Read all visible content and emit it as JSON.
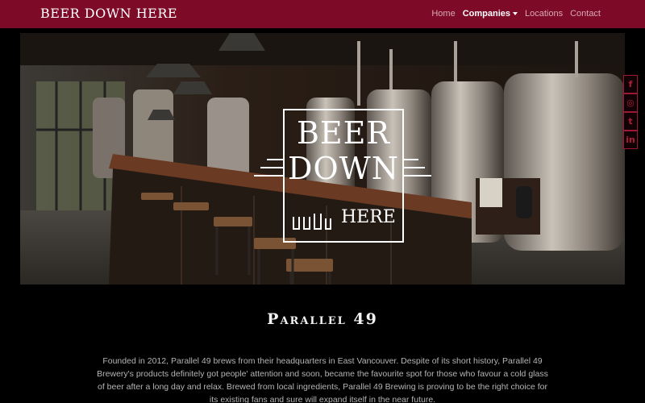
{
  "navbar": {
    "brand": "BEER DOWN HERE",
    "items": [
      {
        "label": "Home",
        "active": false
      },
      {
        "label": "Companies",
        "active": true
      },
      {
        "label": "Locations",
        "active": false
      },
      {
        "label": "Contact",
        "active": false
      }
    ]
  },
  "hero": {
    "logo": {
      "line1": "BEER",
      "line2": "DOWN",
      "line3": "HERE"
    }
  },
  "social": [
    {
      "icon": "facebook-icon",
      "glyph": "f"
    },
    {
      "icon": "instagram-icon",
      "glyph": "◎"
    },
    {
      "icon": "twitter-icon",
      "glyph": "t"
    },
    {
      "icon": "linkedin-icon",
      "glyph": "in"
    }
  ],
  "content": {
    "title": "Parallel 49",
    "description": "Founded in 2012, Parallel 49 brews from their headquarters in East Vancouver. Despite of its short history, Parallel 49 Brewery's products definitely got people' attention and soon, became the favourite spot for those who favour a cold glass of beer after a long day and relax. Brewed from local ingredients, Parallel 49 Brewing is proving to be the right choice for its existing fans and sure will expand itself in the near future."
  },
  "colors": {
    "navbar": "#7d0a26",
    "social": "#b01d3b",
    "background": "#000000"
  }
}
